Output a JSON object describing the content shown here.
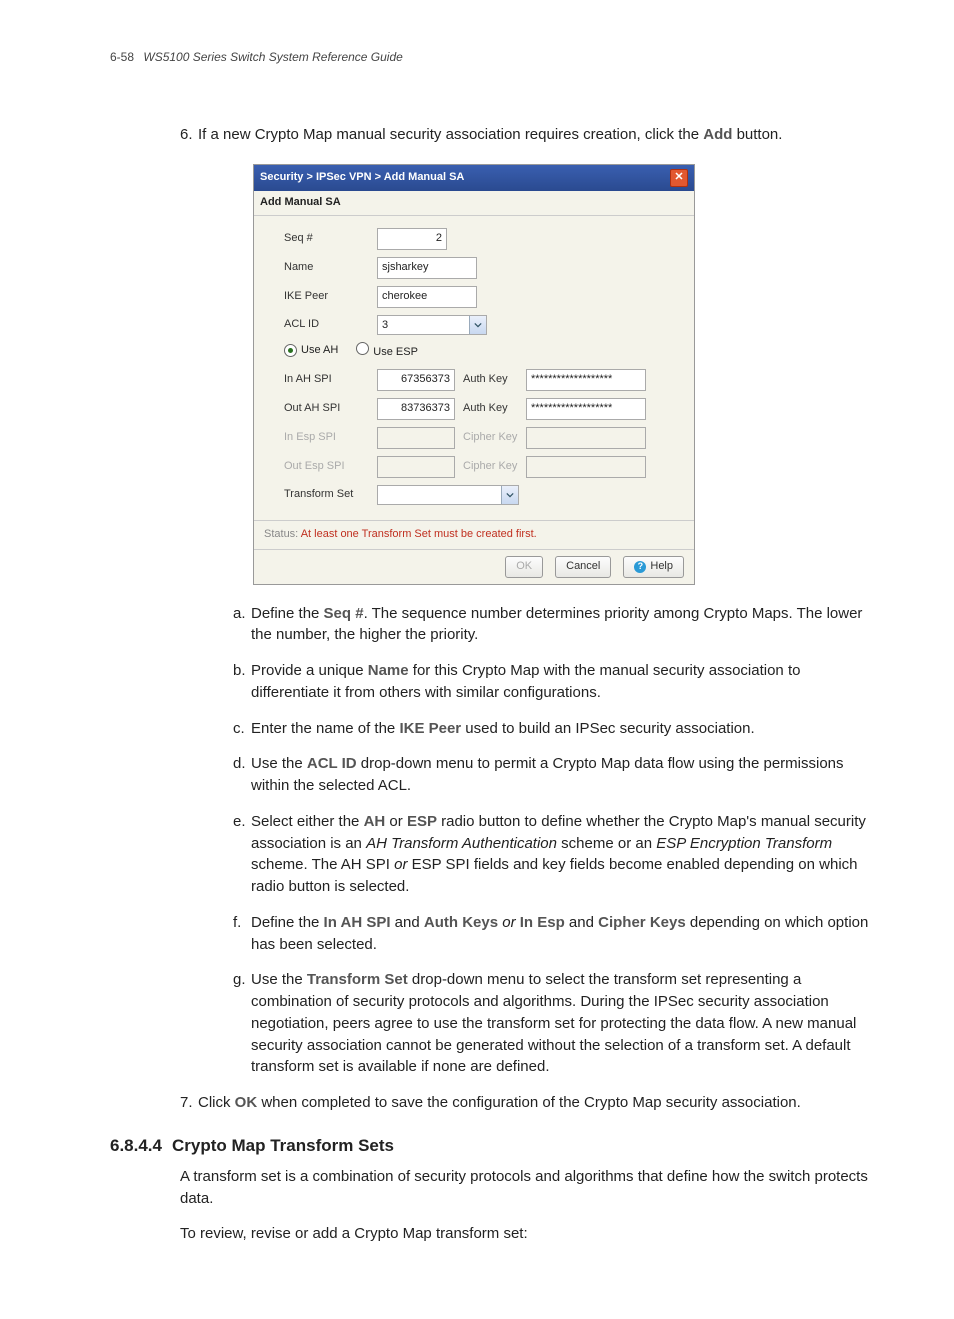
{
  "header": {
    "page_ref": "6-58",
    "doc_title": "WS5100 Series Switch System Reference Guide"
  },
  "step6": {
    "num": "6.",
    "text_before": "If a new Crypto Map manual security association requires creation, click the ",
    "add_term": "Add",
    "text_after": " button."
  },
  "dialog": {
    "breadcrumb": "Security > IPSec VPN > Add Manual SA",
    "section_title": "Add Manual SA",
    "fields": {
      "seq_label": "Seq #",
      "seq_value": "2",
      "name_label": "Name",
      "name_value": "sjsharkey",
      "ike_label": "IKE Peer",
      "ike_value": "cherokee",
      "acl_label": "ACL ID",
      "acl_value": "3",
      "use_ah": "Use AH",
      "use_esp": "Use ESP",
      "in_ah_label": "In AH SPI",
      "in_ah_value": "67356373",
      "out_ah_label": "Out AH SPI",
      "out_ah_value": "83736373",
      "auth_key_label": "Auth Key",
      "auth_key_value": "*******************",
      "in_esp_label": "In Esp SPI",
      "out_esp_label": "Out Esp SPI",
      "cipher_key_label": "Cipher Key",
      "transform_label": "Transform Set"
    },
    "status_label": "Status:",
    "status_msg": "At least one Transform Set must be created first.",
    "buttons": {
      "ok": "OK",
      "cancel": "Cancel",
      "help": "Help"
    }
  },
  "sub_steps": {
    "a": {
      "num": "a.",
      "t1": "Define the ",
      "term": "Seq #",
      "t2": ". The sequence number determines priority among Crypto Maps. The lower the number, the higher the priority."
    },
    "b": {
      "num": "b.",
      "t1": "Provide a unique ",
      "term": "Name",
      "t2": " for this Crypto Map with the manual security association to differentiate it from others with similar configurations."
    },
    "c": {
      "num": "c.",
      "t1": "Enter the name of the ",
      "term": "IKE Peer",
      "t2": " used to build an IPSec security association."
    },
    "d": {
      "num": "d.",
      "t1": "Use the ",
      "term": "ACL ID",
      "t2": " drop-down menu to permit a Crypto Map data flow using the permissions within the selected ACL."
    },
    "e": {
      "num": "e.",
      "t1": "Select either the ",
      "term1": "AH",
      "or": " or ",
      "term2": "ESP",
      "t2": " radio button to define whether the Crypto Map's manual security association is an ",
      "it1": "AH Transform Authentication",
      "t3": " scheme or an ",
      "it2": "ESP Encryption Transform",
      "t4": " scheme. The AH SPI ",
      "it3": "or",
      "t5": " ESP SPI fields and key fields become enabled depending on which radio button is selected."
    },
    "f": {
      "num": "f.",
      "t1": "Define the ",
      "term1": "In AH SPI",
      "and1": " and ",
      "term2": "Auth Keys",
      "or": " or ",
      "term3": "In Esp",
      "and2": " and ",
      "term4": "Cipher Keys",
      "t2": " depending on which option has been selected."
    },
    "g": {
      "num": "g.",
      "t1": "Use the ",
      "term": "Transform Set",
      "t2": " drop-down menu to select the transform set representing a combination of security protocols and algorithms. During the IPSec security association negotiation, peers agree to use the transform set for protecting the data flow. A new manual security association cannot be generated without the selection of a transform set. A default transform set is available if none are defined."
    }
  },
  "step7": {
    "num": "7.",
    "t1": "Click ",
    "term": "OK",
    "t2": " when completed to save the configuration of the Crypto Map security association."
  },
  "section": {
    "num": "6.8.4.4",
    "title": "Crypto Map Transform Sets",
    "p1": "A transform set is a combination of security protocols and algorithms that define how the switch protects data.",
    "p2": "To review, revise or add a Crypto Map transform set:"
  }
}
